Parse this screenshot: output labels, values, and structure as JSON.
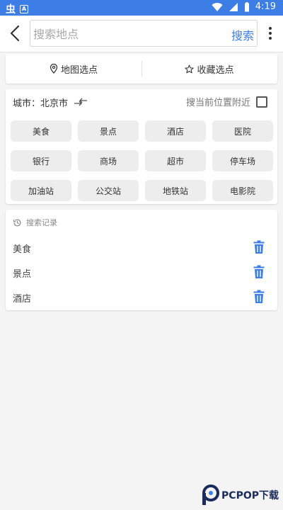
{
  "statusbar": {
    "time": "4:19",
    "left_glyph": "虫",
    "left_badge": "A"
  },
  "search": {
    "placeholder": "搜索地点",
    "button_label": "搜索"
  },
  "pick": {
    "map_label": "地图选点",
    "fav_label": "收藏选点"
  },
  "city": {
    "label": "城市：北京市",
    "nearby_label": "搜当前位置附近"
  },
  "categories": [
    "美食",
    "景点",
    "酒店",
    "医院",
    "银行",
    "商场",
    "超市",
    "停车场",
    "加油站",
    "公交站",
    "地铁站",
    "电影院"
  ],
  "history": {
    "title": "搜索记录",
    "items": [
      "美食",
      "景点",
      "酒店"
    ]
  },
  "watermark": {
    "text": "PCPOP下载"
  },
  "colors": {
    "accent": "#3d7ee6",
    "chip_bg": "#ededed",
    "watermark": "#1b2b5c"
  }
}
